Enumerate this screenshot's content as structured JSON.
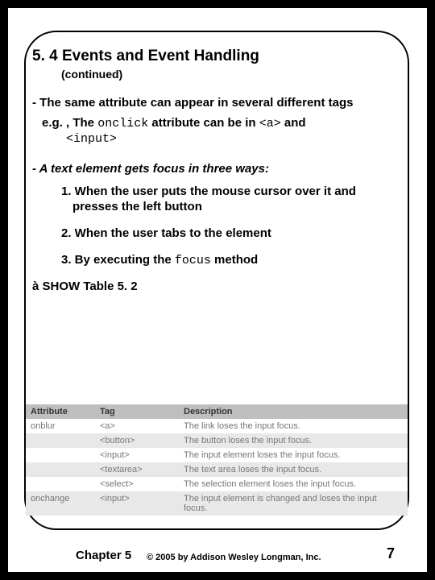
{
  "header": {
    "title": "5. 4 Events and Event Handling",
    "subtitle": "(continued)"
  },
  "bullets": {
    "b1": "- The same attribute can appear in several different tags",
    "b1sub_pre": "e.g. , The ",
    "b1sub_code1": "onclick",
    "b1sub_mid": " attribute can be in ",
    "b1sub_code2": "<a>",
    "b1sub_post": " and",
    "b1sub_line2": "<input>",
    "b2": "- A text element gets focus in three ways:",
    "o1": "1. When the user puts the mouse cursor over it and presses the left button",
    "o2": "2. When the user tabs to the element",
    "o3_pre": "3. By executing the ",
    "o3_code": "focus",
    "o3_post": " method",
    "show_arrow": "à",
    "show_text": " SHOW Table 5. 2"
  },
  "table": {
    "h_attr": "Attribute",
    "h_tag": "Tag",
    "h_desc": "Description",
    "rows": [
      {
        "attr": "onblur",
        "tag": "<a>",
        "desc": "The link loses the input focus."
      },
      {
        "attr": "",
        "tag": "<button>",
        "desc": "The button loses the input focus."
      },
      {
        "attr": "",
        "tag": "<input>",
        "desc": "The input element loses the input focus."
      },
      {
        "attr": "",
        "tag": "<textarea>",
        "desc": "The text area loses the input focus."
      },
      {
        "attr": "",
        "tag": "<select>",
        "desc": "The selection element loses the input focus."
      },
      {
        "attr": "onchange",
        "tag": "<input>",
        "desc": "The input element is changed and loses the input focus."
      }
    ]
  },
  "footer": {
    "chapter": "Chapter 5",
    "copyright": "© 2005 by Addison Wesley Longman, Inc.",
    "page": "7"
  }
}
